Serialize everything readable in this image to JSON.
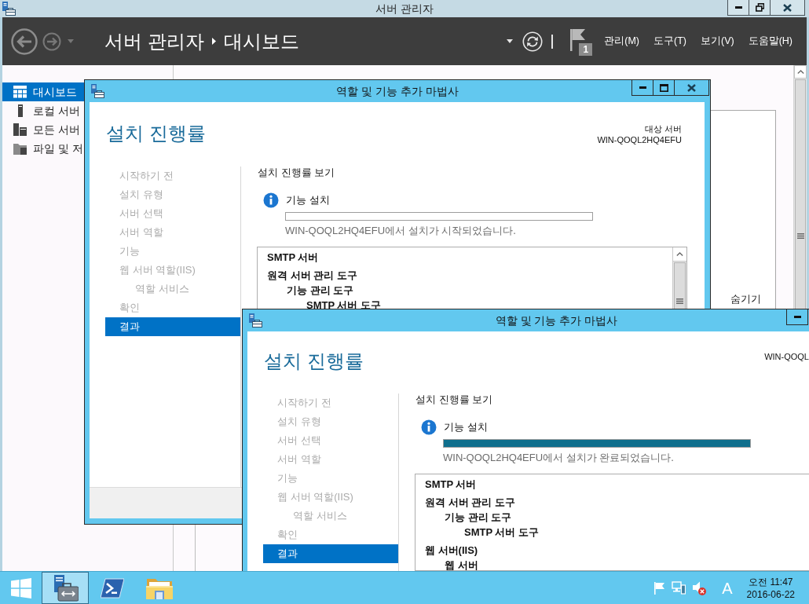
{
  "server_manager": {
    "title": "서버 관리자",
    "breadcrumb": [
      "서버 관리자",
      "대시보드"
    ],
    "notifications": "1",
    "menus": [
      "관리(M)",
      "도구(T)",
      "보기(V)",
      "도움말(H)"
    ],
    "sidebar": [
      {
        "label": "대시보드",
        "selected": true
      },
      {
        "label": "로컬 서버",
        "selected": false
      },
      {
        "label": "모든 서버",
        "selected": false
      },
      {
        "label": "파일 및 저",
        "selected": false
      }
    ],
    "tile_link": "숨기기"
  },
  "wizards": [
    {
      "title": "역할 및 기능 추가 마법사",
      "cut_off": false,
      "heading": "설치 진행률",
      "target_label": "대상 서버",
      "target_server": "WIN-QOQL2HQ4EFU",
      "steps": [
        {
          "label": "시작하기 전",
          "selected": false
        },
        {
          "label": "설치 유형",
          "selected": false
        },
        {
          "label": "서버 선택",
          "selected": false
        },
        {
          "label": "서버 역할",
          "selected": false
        },
        {
          "label": "기능",
          "selected": false
        },
        {
          "label": "웹 서버 역할(IIS)",
          "selected": false,
          "children": [
            {
              "label": "역할 서비스",
              "selected": false
            }
          ]
        },
        {
          "label": "확인",
          "selected": false
        },
        {
          "label": "결과",
          "selected": true
        }
      ],
      "section": "설치 진행률 보기",
      "task": "기능 설치",
      "progress": {
        "level": 0
      },
      "status": "WIN-QOQL2HQ4EFU에서 설치가 시작되었습니다.",
      "results": [
        {
          "label": "SMTP 서버"
        },
        {
          "label": "원격 서버 관리 도구",
          "children": [
            {
              "label": "기능 관리 도구",
              "children": [
                {
                  "label": "SMTP 서버 도구"
                }
              ]
            }
          ]
        }
      ]
    },
    {
      "title": "역할 및 기능 추가 마법사",
      "cut_off": true,
      "heading": "설치 진행률",
      "target_server": "WIN-QOQL",
      "steps": [
        {
          "label": "시작하기 전",
          "selected": false
        },
        {
          "label": "설치 유형",
          "selected": false
        },
        {
          "label": "서버 선택",
          "selected": false
        },
        {
          "label": "서버 역할",
          "selected": false
        },
        {
          "label": "기능",
          "selected": false
        },
        {
          "label": "웹 서버 역할(IIS)",
          "selected": false,
          "children": [
            {
              "label": "역할 서비스",
              "selected": false
            }
          ]
        },
        {
          "label": "확인",
          "selected": false
        },
        {
          "label": "결과",
          "selected": true
        }
      ],
      "section": "설치 진행률 보기",
      "task": "기능 설치",
      "progress": {
        "level": 1
      },
      "status": "WIN-QOQL2HQ4EFU에서 설치가 완료되었습니다.",
      "results": [
        {
          "label": "SMTP 서버"
        },
        {
          "label": "원격 서버 관리 도구",
          "children": [
            {
              "label": "기능 관리 도구",
              "children": [
                {
                  "label": "SMTP 서버 도구"
                }
              ]
            }
          ]
        },
        {
          "label": "웹 서버(IIS)",
          "children": [
            {
              "label": "웹 서버"
            }
          ]
        }
      ]
    }
  ],
  "taskbar": {
    "apps": [
      {
        "selected": true
      },
      {
        "selected": false
      },
      {
        "selected": false
      }
    ],
    "ime": "A",
    "time": "오전 11:47",
    "date": "2016-06-22"
  }
}
